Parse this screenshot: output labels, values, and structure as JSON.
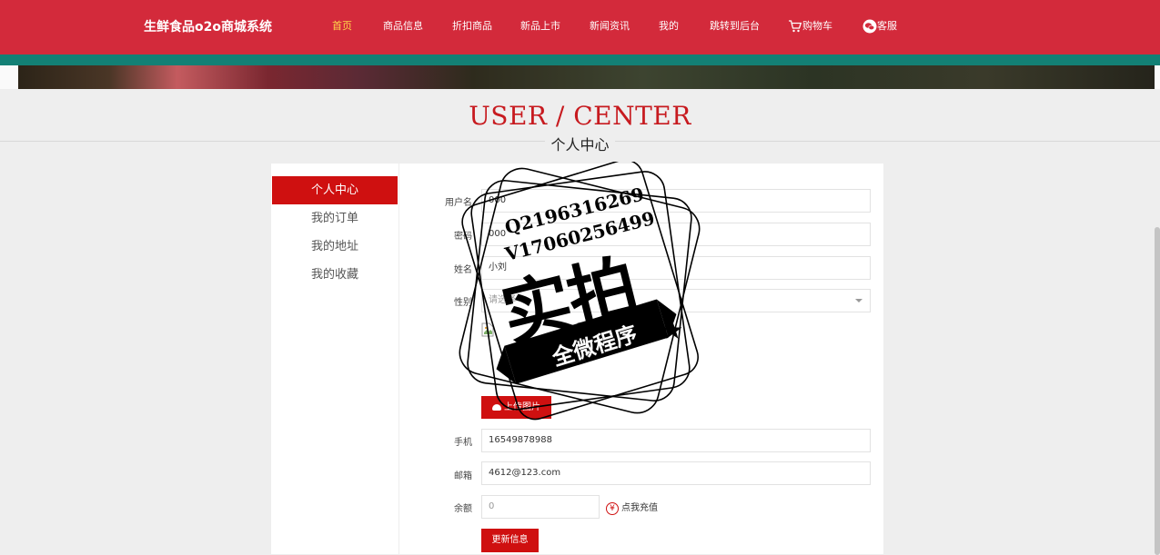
{
  "header": {
    "brand": "生鲜食品o2o商城系统",
    "nav": [
      {
        "label": "首页"
      },
      {
        "label": "商品信息"
      },
      {
        "label": "折扣商品"
      },
      {
        "label": "新品上市"
      },
      {
        "label": "新闻资讯"
      },
      {
        "label": "我的"
      },
      {
        "label": "跳转到后台"
      },
      {
        "label": "购物车",
        "icon": "cart-icon"
      },
      {
        "label": "客服",
        "icon": "chat-icon"
      }
    ],
    "colors": {
      "bar": "#d32a3b",
      "strip": "#138075",
      "active_nav": "#ffd84a"
    }
  },
  "page_title": {
    "en": "USER / CENTER",
    "cn": "个人中心"
  },
  "sidebar": {
    "items": [
      {
        "label": "个人中心",
        "active": true
      },
      {
        "label": "我的订单"
      },
      {
        "label": "我的地址"
      },
      {
        "label": "我的收藏"
      }
    ]
  },
  "form": {
    "username": {
      "label": "用户名",
      "value": "000"
    },
    "password": {
      "label": "密码",
      "value": "000"
    },
    "name": {
      "label": "姓名",
      "value": "小刘"
    },
    "gender": {
      "label": "性别",
      "placeholder": "请选择"
    },
    "upload_label": "上传图片",
    "phone": {
      "label": "手机",
      "value": "16549878988"
    },
    "email": {
      "label": "邮箱",
      "value": "4612@123.com"
    },
    "balance": {
      "label": "余额",
      "value": "0"
    },
    "recharge_label": "点我充值",
    "recharge_icon": "¥",
    "submit_label": "更新信息"
  },
  "watermark": {
    "line1": "Q2196316269",
    "line2": "V17060256499",
    "big": "实拍",
    "band": "全微程序"
  },
  "accent": "#cf1010"
}
